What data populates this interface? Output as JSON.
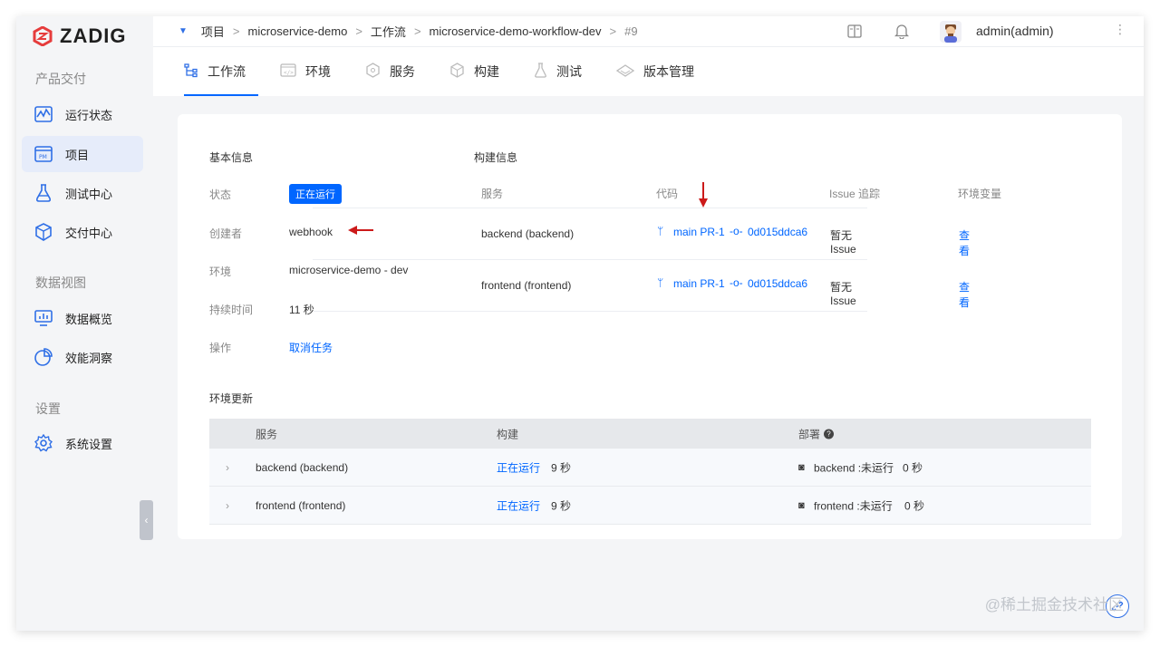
{
  "app": {
    "logo_text": "ZADIG",
    "accent": "#0066ff"
  },
  "sidebar": {
    "sections": [
      "产品交付",
      "数据视图",
      "设置"
    ],
    "items": [
      {
        "label": "运行状态",
        "icon": "pulse-chart-icon"
      },
      {
        "label": "项目",
        "icon": "project-pm-icon"
      },
      {
        "label": "测试中心",
        "icon": "flask-icon"
      },
      {
        "label": "交付中心",
        "icon": "box-cube-icon"
      },
      {
        "label": "数据概览",
        "icon": "monitor-chart-icon"
      },
      {
        "label": "效能洞察",
        "icon": "pie-chart-icon"
      },
      {
        "label": "系统设置",
        "icon": "gear-icon"
      }
    ],
    "collapse_glyph": "‹"
  },
  "topbar": {
    "breadcrumb": [
      "项目",
      "microservice-demo",
      "工作流",
      "microservice-demo-workflow-dev",
      "#9"
    ],
    "user": "admin(admin)"
  },
  "tabs": [
    "工作流",
    "环境",
    "服务",
    "构建",
    "测试",
    "版本管理"
  ],
  "basic": {
    "title": "基本信息",
    "status_label": "状态",
    "status_value": "正在运行",
    "creator_label": "创建者",
    "creator_value": "webhook",
    "env_label": "环境",
    "env_value": "microservice-demo - dev",
    "duration_label": "持续时间",
    "duration_value": "11 秒",
    "op_label": "操作",
    "op_value": "取消任务"
  },
  "build_info": {
    "title": "构建信息",
    "headers": [
      "服务",
      "代码",
      "Issue 追踪",
      "环境变量"
    ],
    "rows": [
      {
        "service": "backend (backend)",
        "branch": "main PR-1",
        "commit": "0d015ddca6",
        "issue": "暂无 Issue",
        "env": "查看"
      },
      {
        "service": "frontend (frontend)",
        "branch": "main PR-1",
        "commit": "0d015ddca6",
        "issue": "暂无 Issue",
        "env": "查看"
      }
    ]
  },
  "env_update": {
    "title": "环境更新",
    "headers": [
      "服务",
      "构建",
      "部署"
    ],
    "help_glyph": "?",
    "rows": [
      {
        "service": "backend (backend)",
        "build_status": "正在运行",
        "build_time": "9 秒",
        "deploy": "backend :未运行",
        "deploy_time": "0 秒"
      },
      {
        "service": "frontend (frontend)",
        "build_status": "正在运行",
        "build_time": "9 秒",
        "deploy": "frontend :未运行",
        "deploy_time": "0 秒"
      }
    ]
  },
  "watermark": "@稀土掘金技术社区"
}
